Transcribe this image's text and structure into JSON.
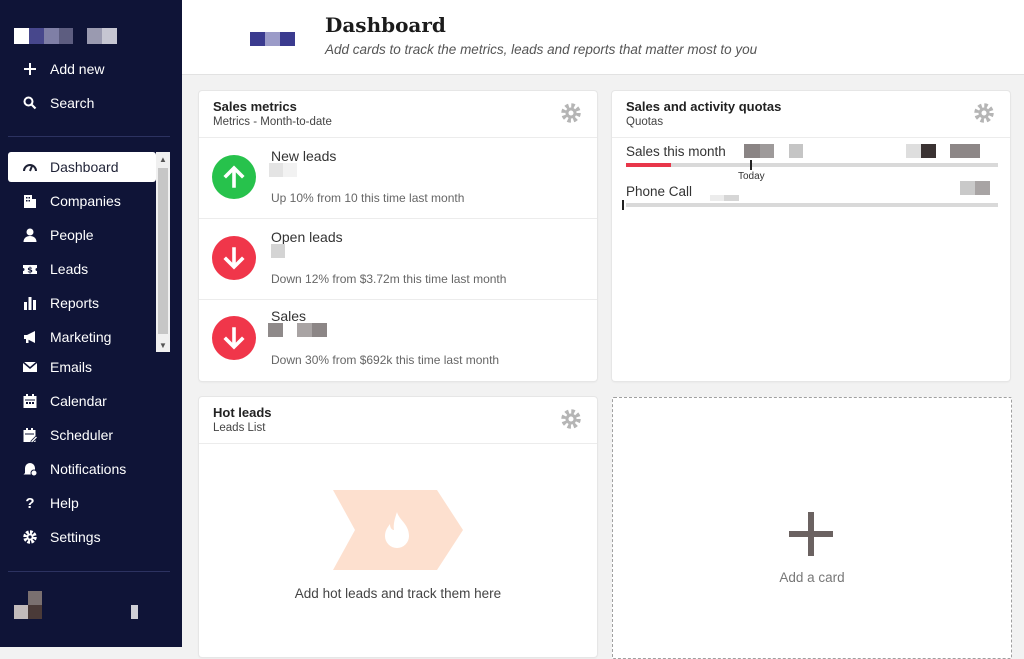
{
  "sidebar": {
    "top_items": [
      {
        "label": "Add new",
        "icon": "plus-icon"
      },
      {
        "label": "Search",
        "icon": "search-icon"
      }
    ],
    "nav_items": [
      {
        "label": "Dashboard",
        "icon": "gauge-icon",
        "active": true
      },
      {
        "label": "Companies",
        "icon": "building-icon"
      },
      {
        "label": "People",
        "icon": "person-icon"
      },
      {
        "label": "Leads",
        "icon": "ticket-dollar-icon"
      },
      {
        "label": "Reports",
        "icon": "bar-chart-icon"
      },
      {
        "label": "Marketing",
        "icon": "megaphone-icon"
      },
      {
        "label": "Emails",
        "icon": "envelope-icon"
      },
      {
        "label": "Calendar",
        "icon": "calendar-icon"
      },
      {
        "label": "Scheduler",
        "icon": "calendar-edit-icon"
      },
      {
        "label": "Notifications",
        "icon": "bell-icon"
      },
      {
        "label": "Help",
        "icon": "question-icon"
      },
      {
        "label": "Settings",
        "icon": "gear-icon"
      }
    ]
  },
  "header": {
    "title": "Dashboard",
    "subtitle": "Add cards to track the metrics, leads and reports that matter most to you"
  },
  "cards": {
    "sales_metrics": {
      "title": "Sales metrics",
      "subtitle": "Metrics - Month-to-date",
      "rows": [
        {
          "name": "New leads",
          "trend": "up",
          "desc": "Up 10% from 10 this time last month"
        },
        {
          "name": "Open leads",
          "trend": "down",
          "desc": "Down 12% from $3.72m this time last month"
        },
        {
          "name": "Sales",
          "trend": "down",
          "desc": "Down 30% from $692k this time last month"
        }
      ]
    },
    "quotas": {
      "title": "Sales and activity quotas",
      "subtitle": "Quotas",
      "items": [
        {
          "label": "Sales this month",
          "progress": 0.12,
          "today_marker": "Today"
        },
        {
          "label": "Phone Call",
          "progress": 0.0
        }
      ]
    },
    "hot_leads": {
      "title": "Hot leads",
      "subtitle": "Leads List",
      "empty_text": "Add hot leads and track them here"
    },
    "add_card": {
      "label": "Add a card"
    }
  },
  "colors": {
    "sidebar_bg": "#0f1437",
    "up_green": "#27c24c",
    "down_red": "#f0364a",
    "hot_shape": "#fde0cf",
    "quota_fill": "#e8364a"
  }
}
